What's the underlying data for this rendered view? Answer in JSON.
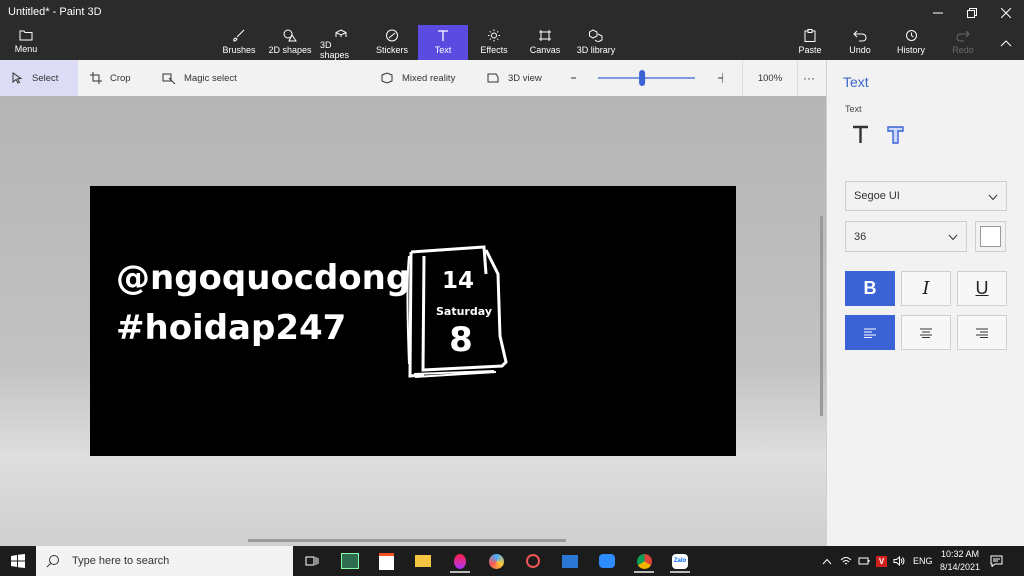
{
  "window": {
    "title": "Untitled* - Paint 3D"
  },
  "ribbon": {
    "menu": "Menu",
    "tools": [
      "Brushes",
      "2D shapes",
      "3D shapes",
      "Stickers",
      "Text",
      "Effects",
      "Canvas",
      "3D library"
    ],
    "active_tool": "Text",
    "right": [
      "Paste",
      "Undo",
      "History",
      "Redo"
    ],
    "disabled": [
      "Redo"
    ]
  },
  "toolbar": {
    "select": "Select",
    "crop": "Crop",
    "magic_select": "Magic select",
    "mixed_reality": "Mixed reality",
    "view3d": "3D view",
    "zoom": "100%",
    "zoom_fraction": 0.42,
    "more": "···"
  },
  "canvas": {
    "line1": "@ngoquocdong",
    "line2": "#hoidap247",
    "calendar_day": "14",
    "calendar_weekday": "Saturday",
    "calendar_month": "8"
  },
  "panel": {
    "title": "Text",
    "subtitle": "Text",
    "font": "Segoe UI",
    "size": "36",
    "bold": "B",
    "italic": "I",
    "underline": "U",
    "text_color": "#ffffff",
    "accent": "#3b63d6"
  },
  "taskbar": {
    "search_placeholder": "Type here to search",
    "lang": "ENG",
    "time": "10:32 AM",
    "date": "8/14/2021"
  }
}
